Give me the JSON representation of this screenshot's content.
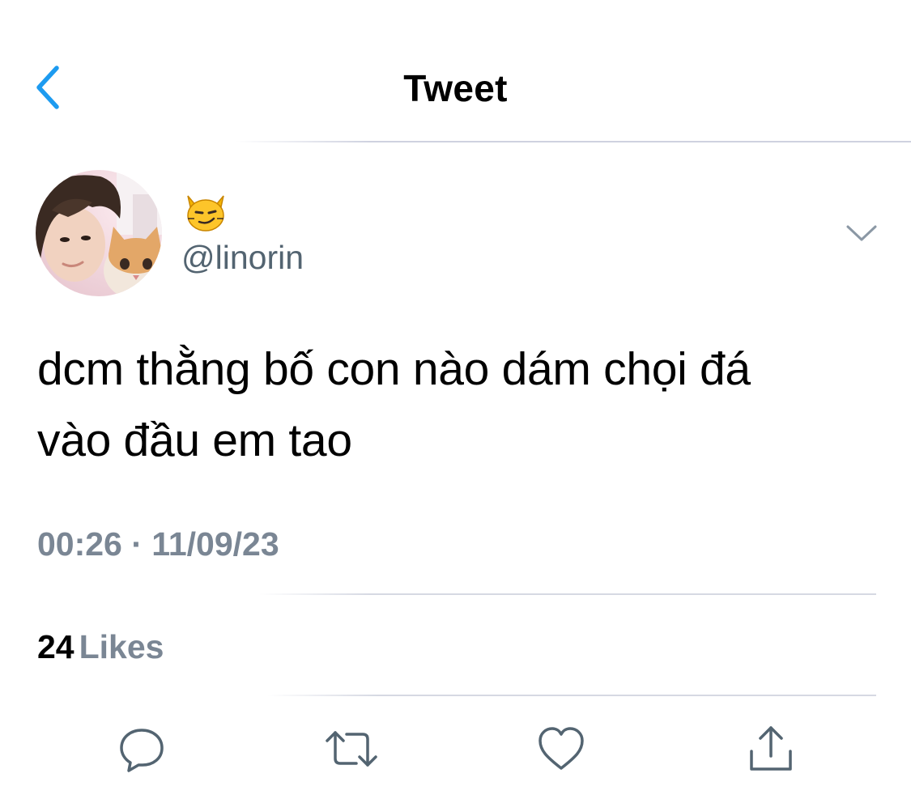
{
  "header": {
    "title": "Tweet",
    "back_icon": "chevron-left-icon",
    "accent_color": "#1d9bf0"
  },
  "tweet": {
    "display_name": "😼",
    "handle": "@linorin",
    "avatar": "avatar-photo",
    "menu_icon": "chevron-down-icon",
    "text": "dcm thằng bố con nào dám chọi đá\nvào đầu em tao",
    "timestamp": "00:26 · 11/09/23",
    "likes_count": "24",
    "likes_label": "Likes"
  },
  "actions": [
    {
      "name": "reply",
      "icon": "reply-icon"
    },
    {
      "name": "retweet",
      "icon": "retweet-icon"
    },
    {
      "name": "like",
      "icon": "heart-icon"
    },
    {
      "name": "share",
      "icon": "share-icon"
    }
  ],
  "colors": {
    "text_primary": "#000000",
    "text_secondary": "#536471",
    "divider": "#cfd2e0",
    "icon_gray": "#536471"
  }
}
